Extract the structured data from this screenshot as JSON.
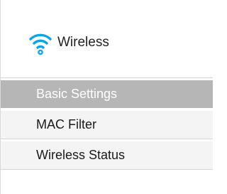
{
  "section": {
    "title": "Wireless",
    "icon": "wifi-icon",
    "icon_color": "#0aa5e6"
  },
  "menu": {
    "items": [
      {
        "label": "Basic Settings",
        "active": true
      },
      {
        "label": "MAC Filter",
        "active": false
      },
      {
        "label": "Wireless Status",
        "active": false
      }
    ],
    "active_bg": "#b6b6b6"
  }
}
